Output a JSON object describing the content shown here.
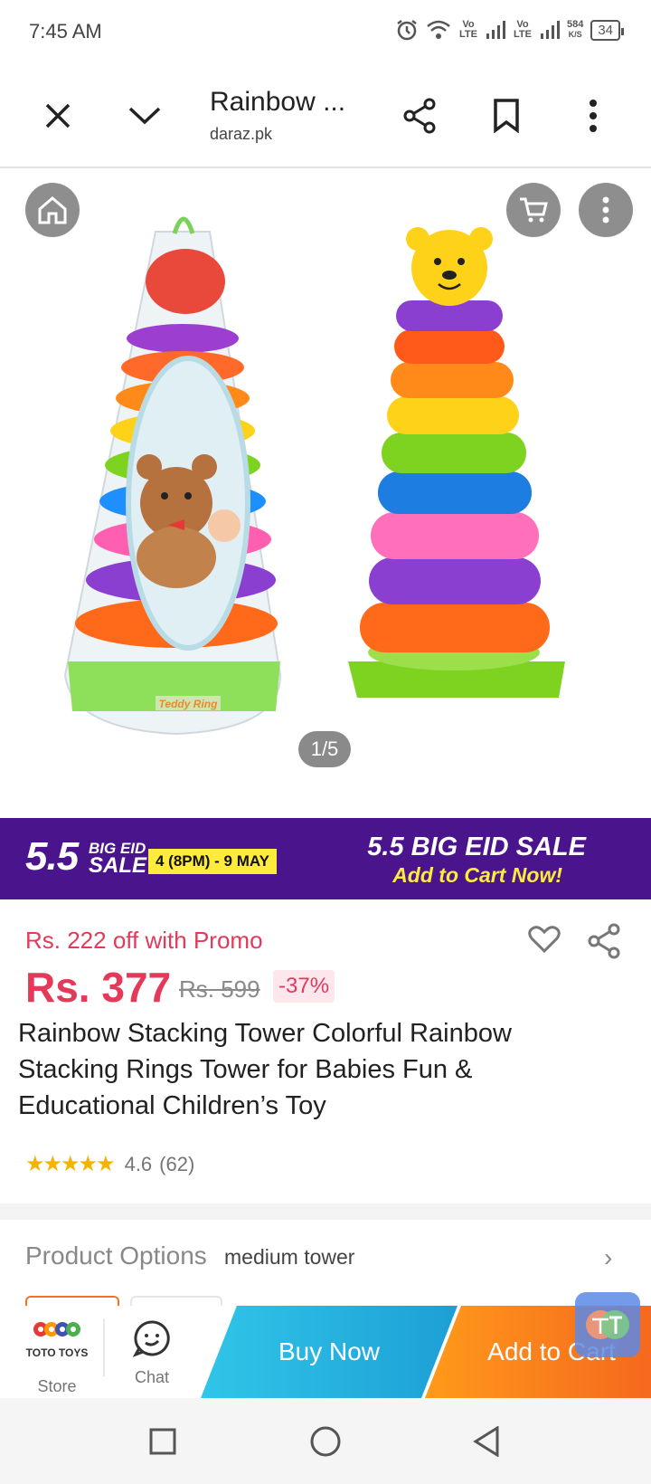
{
  "status_bar": {
    "time": "7:45 AM",
    "net1": "Vo LTE",
    "net2": "Vo LTE",
    "speed_value": "584",
    "speed_unit": "K/S",
    "battery": "34"
  },
  "browser": {
    "title": "Rainbow ...",
    "domain": "daraz.pk"
  },
  "gallery": {
    "counter": "1/5",
    "packaging_label": "Teddy Ring"
  },
  "banner": {
    "number": "5.5",
    "big_eid": "BIG EID",
    "sale": "SALE",
    "dates": "4 (8PM) - 9 MAY",
    "headline": "5.5 BIG EID SALE",
    "cta": "Add to Cart Now!"
  },
  "product": {
    "promo": "Rs. 222 off with Promo",
    "price": "Rs. 377",
    "original_price": "Rs. 599",
    "discount": "-37%",
    "title": "Rainbow Stacking Tower Colorful Rainbow Stacking Rings Tower for Babies Fun & Educational Children’s Toy",
    "rating": "4.6",
    "reviews": "(62)"
  },
  "options": {
    "label": "Product Options",
    "value": "medium tower"
  },
  "actions": {
    "store_logo": "TOTO TOYS",
    "store_label": "Store",
    "chat_label": "Chat",
    "buy_now": "Buy Now",
    "add_to_cart": "Add to Cart"
  },
  "colors": {
    "price": "#e5395a",
    "banner_bg": "#4a148c",
    "buy_now": "#1d9fd6",
    "add_to_cart": "#f5681e"
  }
}
